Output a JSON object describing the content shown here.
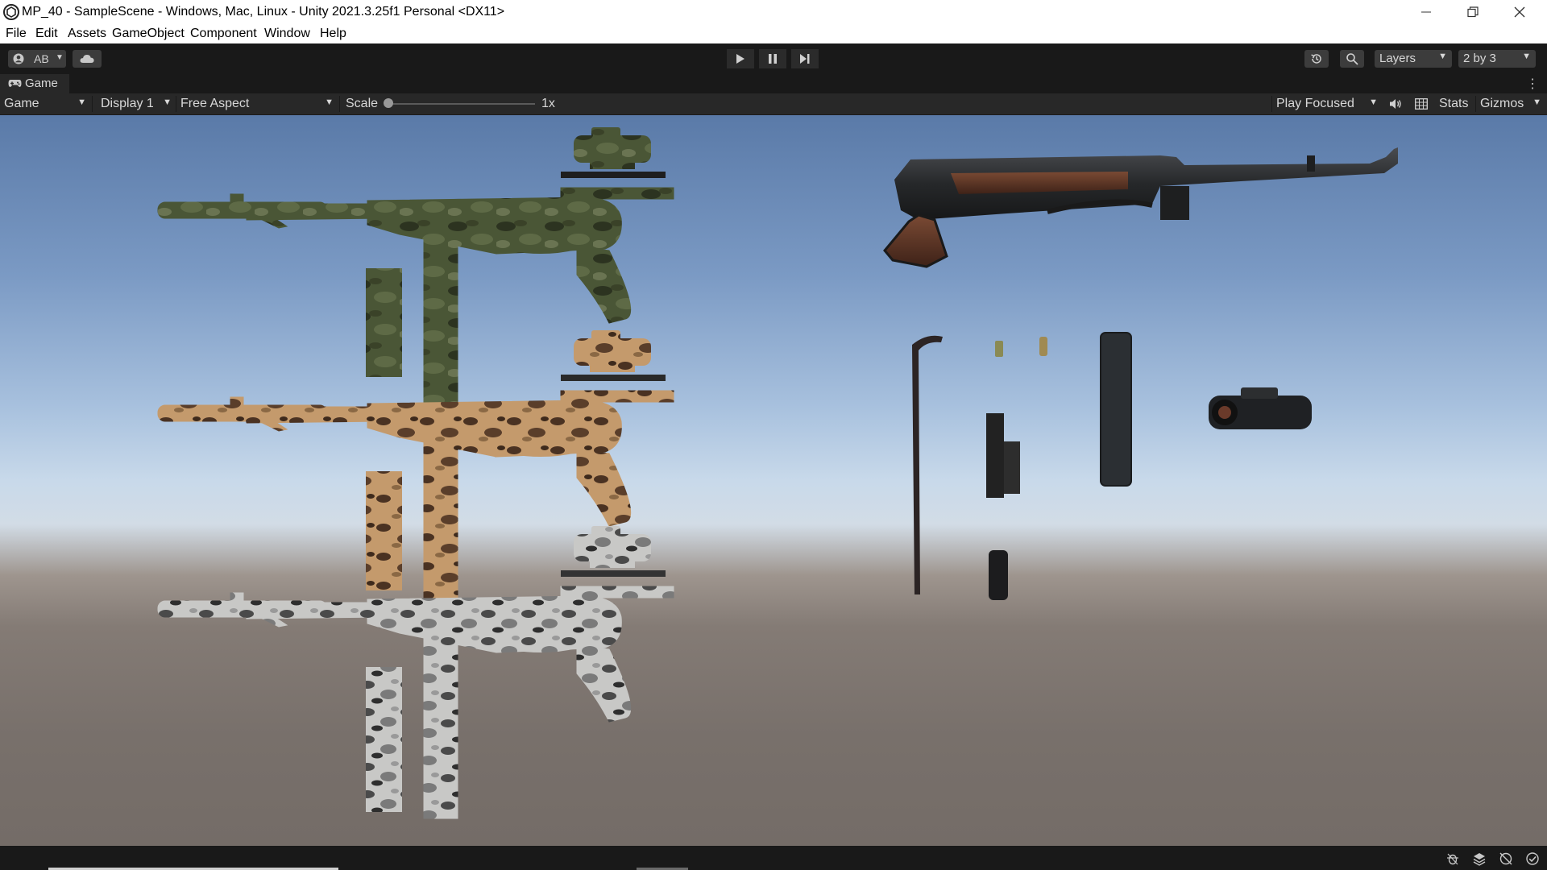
{
  "window": {
    "title": "MP_40 - SampleScene - Windows, Mac, Linux - Unity 2021.3.25f1 Personal <DX11>",
    "app_icon": "unity-logo-icon",
    "controls": [
      "minimize-icon",
      "restore-icon",
      "close-icon"
    ]
  },
  "menu": {
    "items": [
      "File",
      "Edit",
      "Assets",
      "GameObject",
      "Component",
      "Window",
      "Help"
    ]
  },
  "toolbar": {
    "account_label": "AB",
    "cloud_icon": "cloud-icon",
    "play_icons": [
      "play-icon",
      "pause-icon",
      "step-icon"
    ],
    "history_icon": "history-icon",
    "search_icon": "search-icon",
    "layers_label": "Layers",
    "layout_label": "2 by 3"
  },
  "tab": {
    "label": "Game",
    "icon": "gamepad-icon"
  },
  "game_toolbar": {
    "view_select": "Game",
    "display_select": "Display 1",
    "aspect_select": "Free Aspect",
    "scale_label": "Scale",
    "scale_value": "1x",
    "scale_level": 0,
    "play_mode_select": "Play Focused",
    "audio_icon": "speaker-icon",
    "grid_icon": "grid-icon",
    "stats_label": "Stats",
    "gizmos_label": "Gizmos"
  },
  "scene": {
    "objects": [
      "mp40-green-camo-with-scope",
      "mp40-tan-camo-with-scope",
      "mp40-arctic-camo-with-scope",
      "mp40-classic-wood",
      "cleaning-rod",
      "bullet-casing-1",
      "bullet-casing-2",
      "magazine",
      "side-rail",
      "suppressor-part",
      "red-dot-scope"
    ],
    "colors": {
      "green_camo": "#3d4a2c",
      "tan_camo": "#b08860",
      "arctic_camo": "#9a9a9a",
      "metal": "#2a2c2e",
      "wood": "#5a3424"
    }
  },
  "status_bar": {
    "icons": [
      "bug-icon",
      "layers-stack-icon",
      "network-off-icon",
      "check-circle-icon"
    ]
  }
}
